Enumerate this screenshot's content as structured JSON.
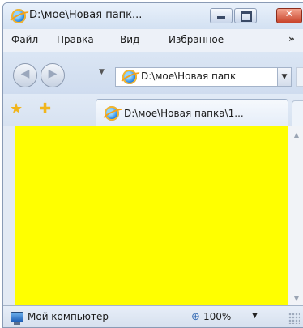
{
  "window": {
    "title": "D:\\мое\\Новая папк..."
  },
  "menu": {
    "items": [
      "Файл",
      "Правка",
      "Вид",
      "Избранное"
    ],
    "overflow": "»"
  },
  "address": {
    "value": "D:\\мое\\Новая папк"
  },
  "tab": {
    "title": "D:\\мое\\Новая папка\\1..."
  },
  "content": {
    "background_color": "#ffff00"
  },
  "status": {
    "zone": "Мой компьютер",
    "zoom": "100%"
  },
  "icons": {
    "browser": "ie-icon",
    "favorites": "favorites-star-icon",
    "add_favorites": "add-favorites-star-icon",
    "computer": "computer-icon",
    "zoom": "zoom-icon"
  }
}
